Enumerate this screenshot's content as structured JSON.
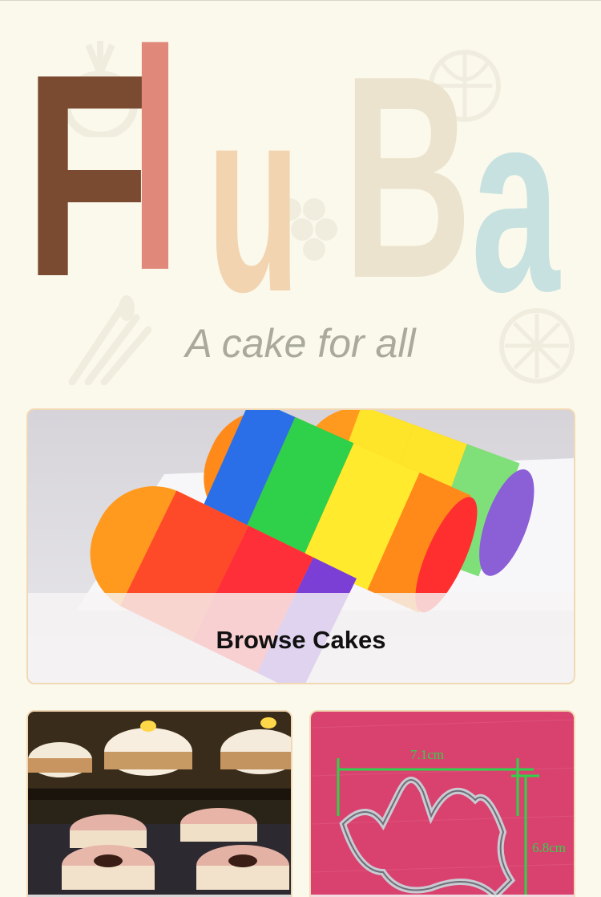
{
  "brand": {
    "letters": [
      {
        "char": "F",
        "color": "#7a4a31"
      },
      {
        "char": "l",
        "color": "#e0897a"
      },
      {
        "char": "u",
        "color": "#f3d4b1"
      },
      {
        "char": "B",
        "color": "#ebe3cd"
      },
      {
        "char": "a",
        "color": "#c6e1e0"
      }
    ],
    "tagline": "A cake for all"
  },
  "cards": {
    "browse": {
      "label": "Browse Cakes",
      "image": "rainbow-roll-cake-photo"
    },
    "cupcakes": {
      "image": "cupcake-display-photo"
    },
    "cutter": {
      "image": "cookie-cutter-photo",
      "dim_width": "7.1cm",
      "dim_height": "6.8cm"
    }
  },
  "colors": {
    "background": "#fbf9ec",
    "card_border": "#f2d9b5",
    "tagline": "#a9a99c",
    "cutter_bg": "#d9426f",
    "measure_line": "#2fd24a"
  }
}
